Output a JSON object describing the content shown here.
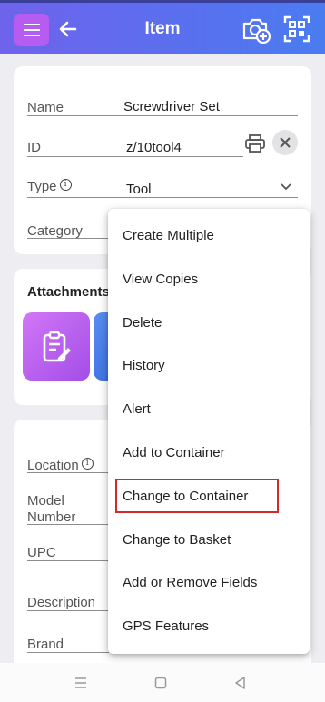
{
  "header": {
    "title": "Item"
  },
  "fields": {
    "name": {
      "label": "Name",
      "value": "Screwdriver Set"
    },
    "id": {
      "label": "ID",
      "value": "z/10tool4"
    },
    "type": {
      "label": "Type",
      "value": "Tool"
    },
    "category": {
      "label": "Category"
    }
  },
  "attachments": {
    "title": "Attachments"
  },
  "fields2": {
    "location": {
      "label": "Location"
    },
    "model_number": {
      "label_line1": "Model",
      "label_line2": "Number"
    },
    "upc": {
      "label": "UPC"
    },
    "description": {
      "label": "Description"
    },
    "brand": {
      "label": "Brand"
    }
  },
  "menu": {
    "items": [
      {
        "label": "Create Multiple"
      },
      {
        "label": "View Copies"
      },
      {
        "label": "Delete"
      },
      {
        "label": "History"
      },
      {
        "label": "Alert"
      },
      {
        "label": "Add to Container"
      },
      {
        "label": "Change to Container"
      },
      {
        "label": "Change to Basket"
      },
      {
        "label": "Add or Remove Fields"
      },
      {
        "label": "GPS Features"
      }
    ]
  },
  "icons": {
    "menu": "hamburger-icon",
    "back": "arrow-left-icon",
    "camera": "camera-add-icon",
    "scan": "qr-scan-icon",
    "print": "printer-icon",
    "clear": "close-icon",
    "info": "info-icon",
    "attachment": "clipboard-edit-icon"
  },
  "colors": {
    "header_start": "#6f63ec",
    "header_end": "#4a7cf0",
    "menu_button": "#b65cf0",
    "highlight_box": "#d22a2a"
  }
}
